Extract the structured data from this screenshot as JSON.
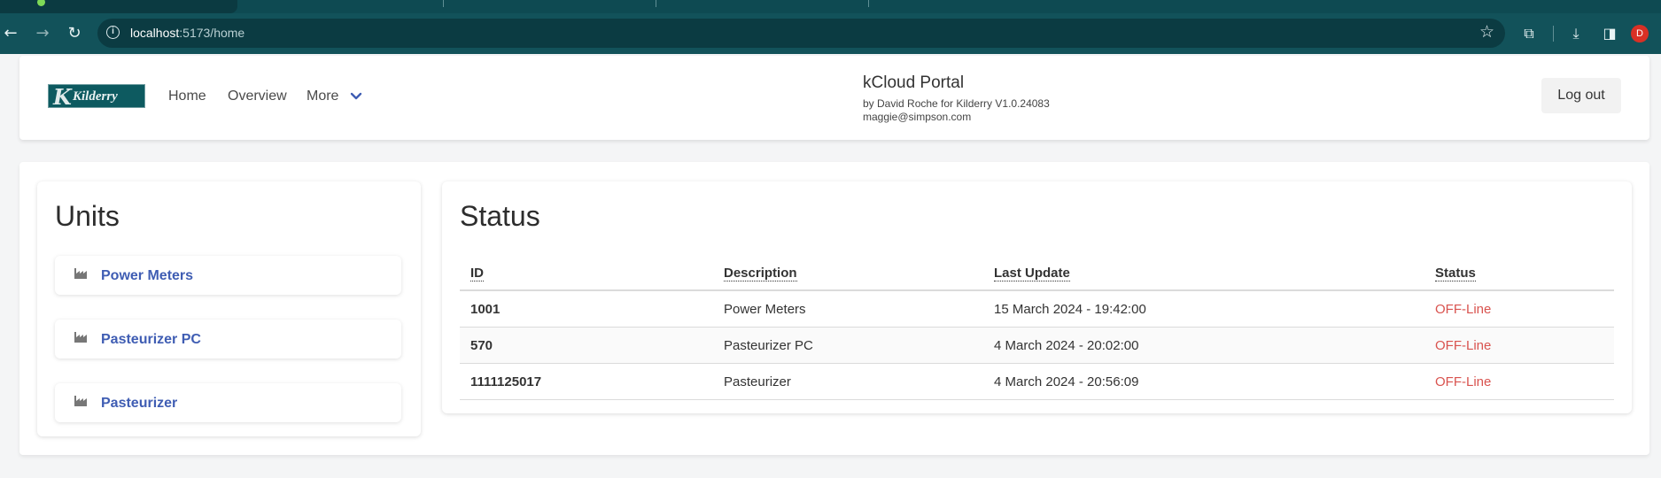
{
  "browser": {
    "url_host": "localhost",
    "url_rest": ":5173/home",
    "profile_initial": "D"
  },
  "header": {
    "nav": [
      "Home",
      "Overview",
      "More"
    ],
    "portal_title": "kCloud Portal",
    "portal_sub": "by David Roche for Kilderry V1.0.24083",
    "user_email": "maggie@simpson.com",
    "logout_label": "Log out",
    "logo_text": "Kilderry"
  },
  "units": {
    "title": "Units",
    "items": [
      "Power Meters",
      "Pasteurizer PC",
      "Pasteurizer"
    ]
  },
  "status": {
    "title": "Status",
    "columns": [
      "ID",
      "Description",
      "Last Update",
      "Status"
    ],
    "rows": [
      {
        "id": "1001",
        "description": "Power Meters",
        "last_update": "15 March 2024 - 19:42:00",
        "status": "OFF-Line"
      },
      {
        "id": "570",
        "description": "Pasteurizer PC",
        "last_update": "4 March 2024 - 20:02:00",
        "status": "OFF-Line"
      },
      {
        "id": "1111125017",
        "description": "Pasteurizer",
        "last_update": "4 March 2024 - 20:56:09",
        "status": "OFF-Line"
      }
    ]
  },
  "colors": {
    "browser_frame": "#12525a",
    "link_blue": "#3f5db3",
    "offline_red": "#d9534f"
  }
}
